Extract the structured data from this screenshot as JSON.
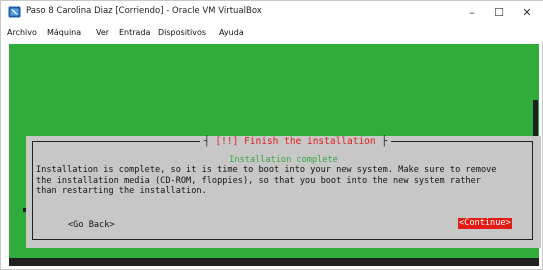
{
  "window": {
    "title": "Paso 8 Carolina Diaz [Corriendo] - Oracle VM VirtualBox",
    "minimize_glyph": "–",
    "maximize_glyph": "☐",
    "close_glyph": "✕"
  },
  "menu": {
    "items": [
      "Archivo",
      "Máquina",
      "Ver",
      "Entrada",
      "Dispositivos",
      "Ayuda"
    ]
  },
  "installer": {
    "dialog_title_marker": "[!!]",
    "dialog_title": "Finish the installation",
    "subtitle": "Installation complete",
    "body": "Installation is complete, so it is time to boot into your new system. Make sure to remove\nthe installation media (CD-ROM, floppies), so that you boot into the new system rather\nthan restarting the installation.",
    "go_back_label": "<Go Back>",
    "continue_label": "<Continue>"
  },
  "colors": {
    "screen_background": "#2fac3a",
    "dialog_background": "#c7c7c7",
    "title_accent": "#e0201c",
    "subtitle_accent": "#38a842",
    "selected_button": "#e21b14"
  },
  "icons": {
    "app": "virtualbox-icon",
    "minimize": "minimize-icon",
    "maximize": "maximize-icon",
    "close": "close-icon"
  }
}
